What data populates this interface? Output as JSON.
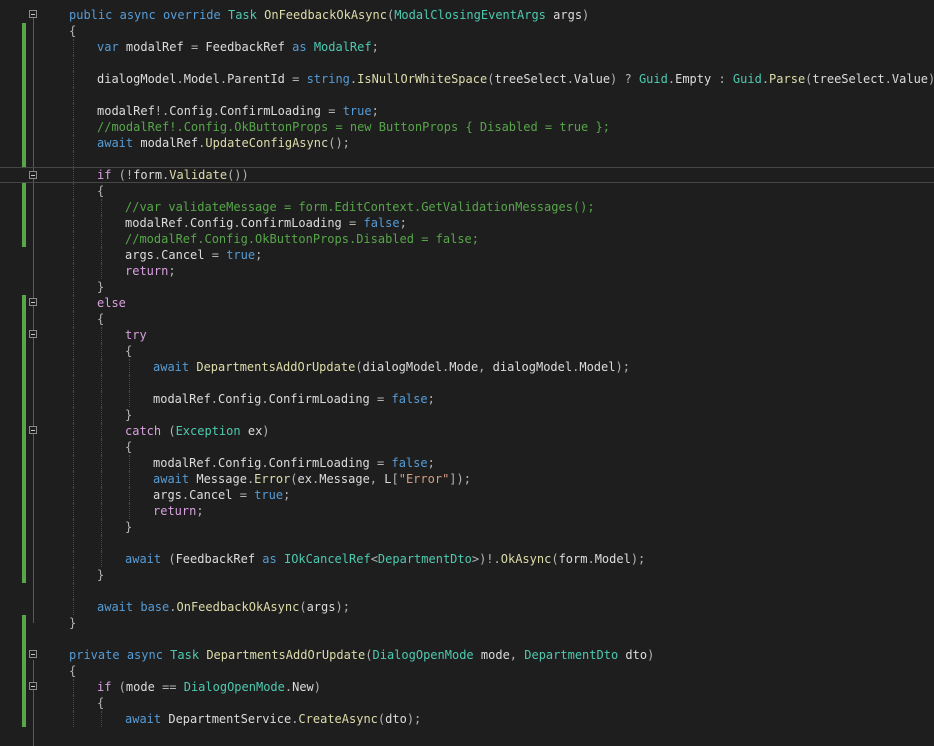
{
  "editor": {
    "lines": [
      {
        "text": "public async override Task OnFeedbackOkAsync(ModalClosingEventArgs args)",
        "indent": 0,
        "changed": false,
        "fold": true
      },
      {
        "text": "{",
        "indent": 0,
        "changed": true,
        "fold": false
      },
      {
        "text": "var modalRef = FeedbackRef as ModalRef;",
        "indent": 1,
        "changed": true,
        "fold": false
      },
      {
        "text": "",
        "indent": 1,
        "changed": true,
        "fold": false
      },
      {
        "text": "dialogModel.Model.ParentId = string.IsNullOrWhiteSpace(treeSelect.Value) ? Guid.Empty : Guid.Parse(treeSelect.Value);",
        "indent": 1,
        "changed": true,
        "fold": false
      },
      {
        "text": "",
        "indent": 1,
        "changed": true,
        "fold": false
      },
      {
        "text": "modalRef!.Config.ConfirmLoading = true;",
        "indent": 1,
        "changed": true,
        "fold": false
      },
      {
        "text": "//modalRef!.Config.OkButtonProps = new ButtonProps { Disabled = true };",
        "indent": 1,
        "changed": true,
        "fold": false
      },
      {
        "text": "await modalRef.UpdateConfigAsync();",
        "indent": 1,
        "changed": true,
        "fold": false
      },
      {
        "text": "",
        "indent": 1,
        "changed": true,
        "fold": false
      },
      {
        "text": "if (!form.Validate())",
        "indent": 1,
        "changed": false,
        "fold": true
      },
      {
        "text": "{",
        "indent": 1,
        "changed": true,
        "fold": false
      },
      {
        "text": "//var validateMessage = form.EditContext.GetValidationMessages();",
        "indent": 2,
        "changed": true,
        "fold": false
      },
      {
        "text": "modalRef.Config.ConfirmLoading = false;",
        "indent": 2,
        "changed": true,
        "fold": false
      },
      {
        "text": "//modalRef.Config.OkButtonProps.Disabled = false;",
        "indent": 2,
        "changed": true,
        "fold": false
      },
      {
        "text": "args.Cancel = true;",
        "indent": 2,
        "changed": false,
        "fold": false
      },
      {
        "text": "return;",
        "indent": 2,
        "changed": false,
        "fold": false
      },
      {
        "text": "}",
        "indent": 1,
        "changed": false,
        "fold": false
      },
      {
        "text": "else",
        "indent": 1,
        "changed": true,
        "fold": true
      },
      {
        "text": "{",
        "indent": 1,
        "changed": true,
        "fold": false
      },
      {
        "text": "try",
        "indent": 2,
        "changed": true,
        "fold": true
      },
      {
        "text": "{",
        "indent": 2,
        "changed": true,
        "fold": false
      },
      {
        "text": "await DepartmentsAddOrUpdate(dialogModel.Mode, dialogModel.Model);",
        "indent": 3,
        "changed": true,
        "fold": false
      },
      {
        "text": "",
        "indent": 3,
        "changed": true,
        "fold": false
      },
      {
        "text": "modalRef.Config.ConfirmLoading = false;",
        "indent": 3,
        "changed": true,
        "fold": false
      },
      {
        "text": "}",
        "indent": 2,
        "changed": true,
        "fold": false
      },
      {
        "text": "catch (Exception ex)",
        "indent": 2,
        "changed": true,
        "fold": true
      },
      {
        "text": "{",
        "indent": 2,
        "changed": true,
        "fold": false
      },
      {
        "text": "modalRef.Config.ConfirmLoading = false;",
        "indent": 3,
        "changed": true,
        "fold": false
      },
      {
        "text": "await Message.Error(ex.Message, L[\"Error\"]);",
        "indent": 3,
        "changed": true,
        "fold": false
      },
      {
        "text": "args.Cancel = true;",
        "indent": 3,
        "changed": true,
        "fold": false
      },
      {
        "text": "return;",
        "indent": 3,
        "changed": true,
        "fold": false
      },
      {
        "text": "}",
        "indent": 2,
        "changed": true,
        "fold": false
      },
      {
        "text": "",
        "indent": 2,
        "changed": true,
        "fold": false
      },
      {
        "text": "await (FeedbackRef as IOkCancelRef<DepartmentDto>)!.OkAsync(form.Model);",
        "indent": 2,
        "changed": true,
        "fold": false
      },
      {
        "text": "}",
        "indent": 1,
        "changed": true,
        "fold": false
      },
      {
        "text": "",
        "indent": 1,
        "changed": false,
        "fold": false
      },
      {
        "text": "await base.OnFeedbackOkAsync(args);",
        "indent": 1,
        "changed": false,
        "fold": false
      },
      {
        "text": "}",
        "indent": 0,
        "changed": true,
        "fold": false
      },
      {
        "text": "",
        "indent": 0,
        "changed": true,
        "fold": false
      },
      {
        "text": "private async Task DepartmentsAddOrUpdate(DialogOpenMode mode, DepartmentDto dto)",
        "indent": 0,
        "changed": true,
        "fold": true
      },
      {
        "text": "{",
        "indent": 0,
        "changed": true,
        "fold": false
      },
      {
        "text": "if (mode == DialogOpenMode.New)",
        "indent": 1,
        "changed": true,
        "fold": true
      },
      {
        "text": "{",
        "indent": 1,
        "changed": true,
        "fold": false
      },
      {
        "text": "await DepartmentService.CreateAsync(dto);",
        "indent": 2,
        "changed": true,
        "fold": false
      }
    ]
  }
}
